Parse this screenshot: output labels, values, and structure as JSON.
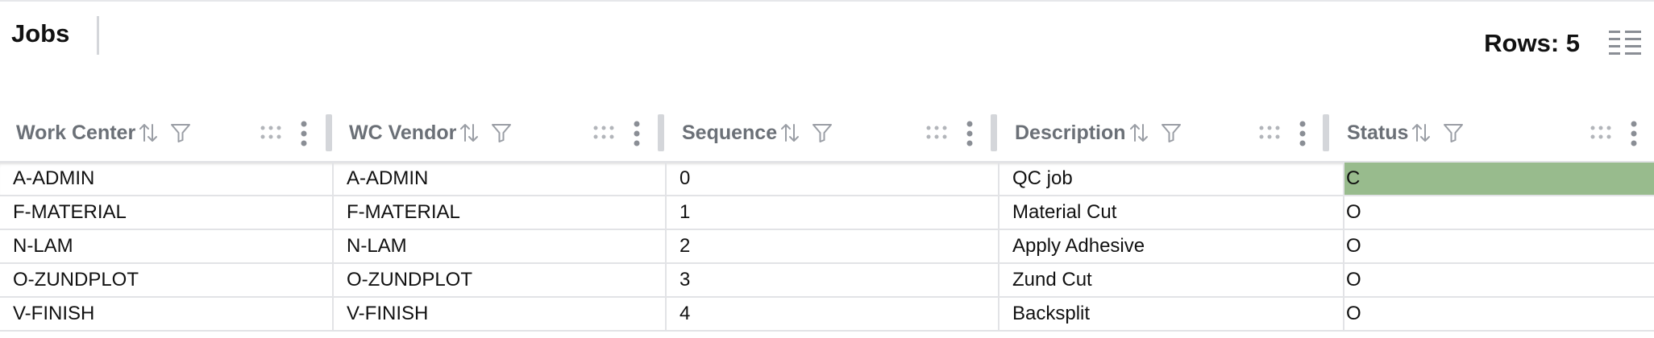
{
  "header": {
    "title": "Jobs",
    "rows_label": "Rows: 5"
  },
  "columns": [
    {
      "label": "Work Center"
    },
    {
      "label": "WC Vendor"
    },
    {
      "label": "Sequence"
    },
    {
      "label": "Description"
    },
    {
      "label": "Status"
    }
  ],
  "rows": [
    {
      "work_center": "A-ADMIN",
      "wc_vendor": "A-ADMIN",
      "sequence": "0",
      "description": "QC job",
      "status": "C"
    },
    {
      "work_center": "F-MATERIAL",
      "wc_vendor": "F-MATERIAL",
      "sequence": "1",
      "description": "Material Cut",
      "status": "O"
    },
    {
      "work_center": "N-LAM",
      "wc_vendor": "N-LAM",
      "sequence": "2",
      "description": "Apply Adhesive",
      "status": "O"
    },
    {
      "work_center": "O-ZUNDPLOT",
      "wc_vendor": "O-ZUNDPLOT",
      "sequence": "3",
      "description": "Zund Cut",
      "status": "O"
    },
    {
      "work_center": "V-FINISH",
      "wc_vendor": "V-FINISH",
      "sequence": "4",
      "description": "Backsplit",
      "status": "O"
    }
  ],
  "colors": {
    "status_complete_bg": "#98bb8d",
    "header_text": "#6b7077",
    "border": "#e2e3e6"
  },
  "icons": {
    "sort": "sort-arrows-icon",
    "filter": "filter-icon",
    "drag": "grip-icon",
    "menu": "kebab-menu-icon",
    "columns": "column-chooser-icon"
  }
}
